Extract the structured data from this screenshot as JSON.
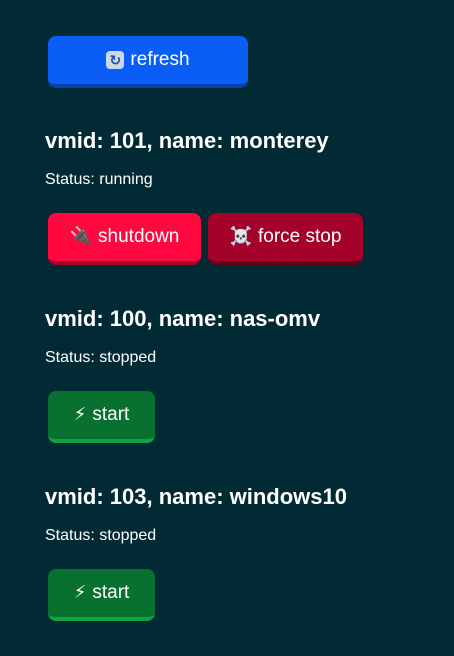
{
  "toolbar": {
    "refresh_icon": "refresh-icon",
    "refresh_label": "refresh"
  },
  "vms": [
    {
      "title": "vmid: 101, name: monterey",
      "status": "Status: running",
      "actions": [
        {
          "icon": "🔌",
          "label": "shutdown",
          "color": "#ff0840"
        },
        {
          "icon": "☠️",
          "label": "force stop",
          "color": "#a4012b"
        }
      ]
    },
    {
      "title": "vmid: 100, name: nas-omv",
      "status": "Status: stopped",
      "actions": [
        {
          "icon": "⚡",
          "label": "start",
          "color": "#08712f"
        }
      ]
    },
    {
      "title": "vmid: 103, name: windows10",
      "status": "Status: stopped",
      "actions": [
        {
          "icon": "⚡",
          "label": "start",
          "color": "#08712f"
        }
      ]
    }
  ],
  "colors": {
    "background": "#022a35",
    "refresh": "#0a5ef5"
  }
}
